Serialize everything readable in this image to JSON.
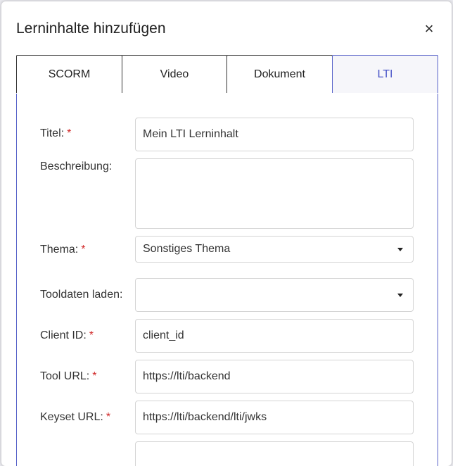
{
  "dialog": {
    "title": "Lerninhalte hinzufügen",
    "close_label": "×"
  },
  "tabs": [
    {
      "label": "SCORM",
      "active": false
    },
    {
      "label": "Video",
      "active": false
    },
    {
      "label": "Dokument",
      "active": false
    },
    {
      "label": "LTI",
      "active": true
    }
  ],
  "form": {
    "required_marker": "*",
    "title": {
      "label": "Titel:",
      "value": "Mein LTI Lerninhalt"
    },
    "description": {
      "label": "Beschreibung:",
      "value": ""
    },
    "topic": {
      "label": "Thema:",
      "value": "Sonstiges Thema"
    },
    "tool_data": {
      "label": "Tooldaten laden:",
      "value": ""
    },
    "client_id": {
      "label": "Client ID:",
      "value": "client_id"
    },
    "tool_url": {
      "label": "Tool URL:",
      "value": "https://lti/backend"
    },
    "keyset_url": {
      "label": "Keyset URL:",
      "value": "https://lti/backend/lti/jwks"
    }
  },
  "colors": {
    "accent": "#4a56c8",
    "required": "#d12a2a"
  }
}
